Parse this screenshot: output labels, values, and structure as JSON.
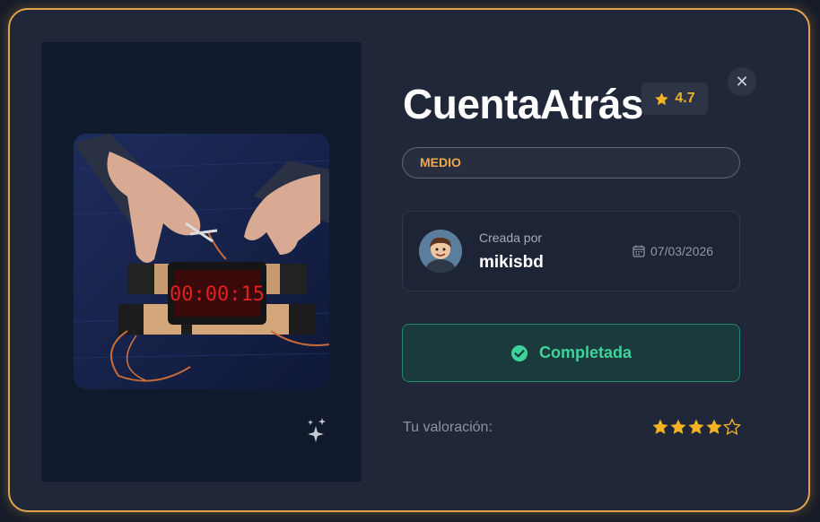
{
  "game": {
    "title": "CuentaAtrás",
    "rating": "4.7",
    "difficulty": "MEDIO",
    "timer_display": "00:00:15"
  },
  "creator": {
    "label": "Creada por",
    "name": "mikisbd",
    "date": "07/03/2026"
  },
  "status": {
    "label": "Completada"
  },
  "user_rating": {
    "label": "Tu valoración:",
    "value": 4,
    "max": 5
  },
  "colors": {
    "accent_border": "#e0a24a",
    "star": "#f3b324",
    "success": "#3ed39a",
    "difficulty": "#f0a84e"
  },
  "icons": [
    "sparkle-icon",
    "close-icon",
    "star-icon",
    "avatar",
    "calendar-icon",
    "check-circle-icon"
  ]
}
